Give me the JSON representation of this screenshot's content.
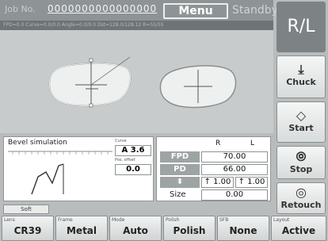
{
  "header": {
    "job_no_label": "Job No.",
    "job_no_value": "0000000000000000",
    "menu_label": "Menu",
    "status": "Standby"
  },
  "info_strip": "FPD=0.0   Curve=0.0/0.0   Angle=0.0/0.0   Dst=128.0/128.12   R=55/55",
  "bevel": {
    "title": "Bevel simulation",
    "curve_label": "Curve",
    "curve_value": "A 3.6",
    "pos_offset_label": "Pos. offset",
    "pos_offset_value": "0.0"
  },
  "params": {
    "col_r": "R",
    "col_l": "L",
    "fpd_label": "FPD",
    "fpd_value": "70.00",
    "pd_label": "PD",
    "pd_value": "66.00",
    "height_label": "⬍",
    "height_r": "↑ 1.00",
    "height_l": "↑ 1.00",
    "size_label": "Size",
    "size_value": "0.00"
  },
  "side": {
    "rl": "R/L",
    "chuck": "Chuck",
    "start": "Start",
    "stop": "Stop",
    "retouch": "Retouch"
  },
  "tabs": {
    "soft": "Soft"
  },
  "bottom": {
    "lens_cap": "Lens",
    "lens_val": "CR39",
    "frame_cap": "Frame",
    "frame_val": "Metal",
    "mode_cap": "Mode",
    "mode_val": "Auto",
    "polish_cap": "Polish",
    "polish_val": "Polish",
    "sfb_cap": "SFB",
    "sfb_val": "None",
    "layout_cap": "Layout",
    "layout_val": "Active"
  },
  "colors": {
    "background": "#b9bcbd",
    "topbar": "#8e9395",
    "rl_button": "#7d8385"
  }
}
